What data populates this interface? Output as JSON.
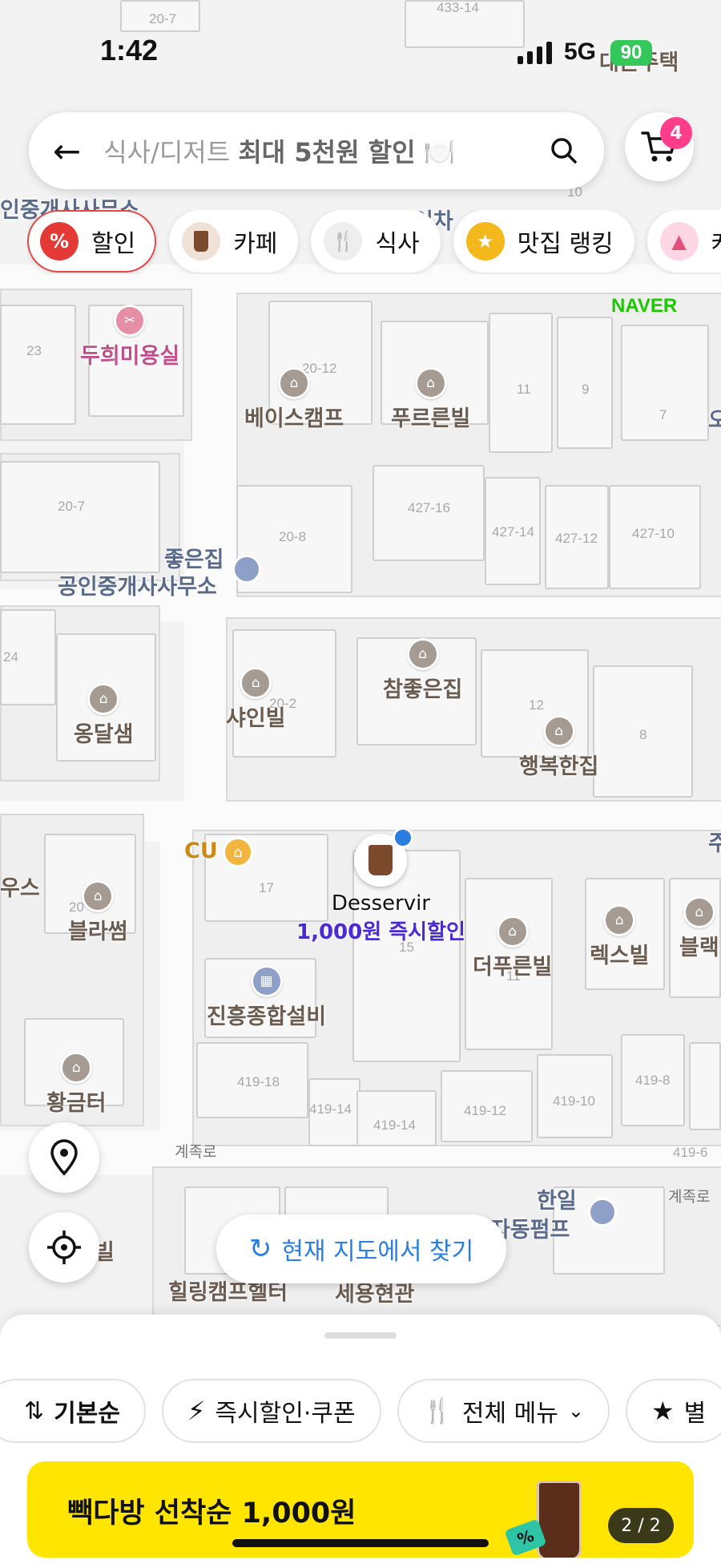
{
  "status": {
    "time": "1:42",
    "network": "5G",
    "battery": "90"
  },
  "search": {
    "placeholder_prefix": "식사/디저트 ",
    "placeholder_bold": "최대 5천원 할인",
    "placeholder_emoji": "🍽️"
  },
  "cart": {
    "badge": "4"
  },
  "chips": [
    {
      "label": "할인",
      "icon": "discount-icon"
    },
    {
      "label": "카페",
      "icon": "coffee-cup-icon"
    },
    {
      "label": "식사",
      "icon": "fork-spoon-icon"
    },
    {
      "label": "맛집 랭킹",
      "icon": "medal-icon"
    },
    {
      "label": "케",
      "icon": "cake-icon"
    }
  ],
  "map": {
    "brand": "NAVER",
    "lot_numbers": [
      "20-7",
      "433-14",
      "23",
      "20-12",
      "11",
      "9",
      "7",
      "20-7",
      "427-16",
      "20-8",
      "427-14",
      "427-12",
      "427-10",
      "24",
      "20-2",
      "12",
      "8",
      "17",
      "15",
      "11",
      "20",
      "419-18",
      "419-14",
      "419-14",
      "419-12",
      "419-10",
      "419-8",
      "419-6",
      "10"
    ],
    "places": {
      "hair": "두희미용실",
      "basecamp": "베이스캠프",
      "pureun": "푸르른빌",
      "joeun_1": "좋은집",
      "joeun_2": "공인중개사사무소",
      "chamjoeun": "참좋은집",
      "shine": "샤인빌",
      "ongdal": "옹달샘",
      "happy": "행복한집",
      "cu": "CU",
      "desservir_name": "Desservir",
      "desservir_deal": "1,000원 즉시할인",
      "blossom": "블라썸",
      "dapureun": "더푸른빌",
      "rex": "렉스빌",
      "black": "블랙",
      "jinheung": "진흥종합설비",
      "golden": "황금터",
      "hanil_1": "한일",
      "hanil_2": "자동펌프",
      "healing": "힐링캠프헬터",
      "sehyeon": "세용현관",
      "daedon": "대돈주택",
      "left_agent": "인중개사사무소",
      "left_us": "우스",
      "left_bil": "빌",
      "right_o": "오",
      "right_ju": "주",
      "chacha": "이차"
    },
    "roads": {
      "road1": "계족로",
      "road2": "계족로"
    },
    "refresh_label": "현재 지도에서 찾기"
  },
  "sheet": {
    "sorts": [
      {
        "label": "기본순",
        "icon": "sort-arrows-icon"
      },
      {
        "label": "즉시할인·쿠폰",
        "icon": "lightning-icon"
      },
      {
        "label": "전체 메뉴",
        "icon": "utensils-icon"
      },
      {
        "label": "별",
        "icon": "star-icon"
      }
    ],
    "banner_text": "빽다방 선착순 1,000원",
    "banner_count": "2 / 2"
  },
  "colors": {
    "accent_blue": "#2a7de1",
    "chip_active": "#e04848",
    "banner_bg": "#ffe500",
    "badge": "#ff3d8b",
    "deal_text": "#4a2bd1"
  }
}
